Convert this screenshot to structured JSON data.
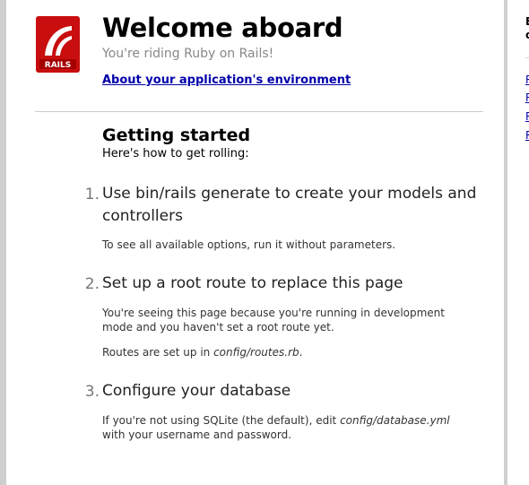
{
  "header": {
    "title": "Welcome aboard",
    "subtitle": "You're riding Ruby on Rails!",
    "env_link": "About your application's environment",
    "logo_text": "RAILS"
  },
  "getting_started": {
    "heading": "Getting started",
    "subheading": "Here's how to get rolling:"
  },
  "steps": [
    {
      "number": "1.",
      "title": "Use bin/rails generate to create your models and controllers",
      "text": "To see all available options, run it without parameters."
    },
    {
      "number": "2.",
      "title": "Set up a root route to replace this page",
      "text": "You're seeing this page because you're running in development mode and you haven't set a root route yet.",
      "note_prefix": "Routes are set up in ",
      "note_file": "config/routes.rb",
      "note_suffix": "."
    },
    {
      "number": "3.",
      "title": "Configure your database",
      "text_prefix": "If you're not using SQLite (the default), edit ",
      "text_file": "config/database.yml",
      "text_suffix": " with your username and password."
    }
  ],
  "sidebar": {
    "title_line1": "B",
    "title_line2": "o",
    "links": [
      "R",
      "R",
      "R",
      "R"
    ]
  },
  "colors": {
    "logo_red": "#cc0000",
    "link_blue": "#0000aa",
    "muted_gray": "#888888",
    "border_gray": "#cfcfcf"
  }
}
